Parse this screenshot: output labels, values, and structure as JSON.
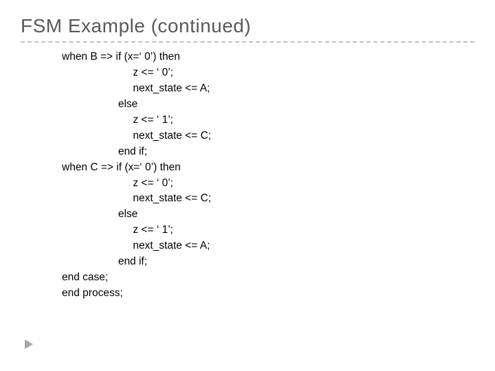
{
  "title": "FSM Example (continued)",
  "code": {
    "l01": "when B => if (x=‘ 0’) then",
    "l02": "                        z <= ‘ 0’;",
    "l03": "                        next_state <= A;",
    "l04": "                   else",
    "l05": "                        z <= ‘ 1’;",
    "l06": "                        next_state <= C;",
    "l07": "                   end if;",
    "l08": "when C => if (x=‘ 0’) then",
    "l09": "                        z <= ‘ 0’;",
    "l10": "                        next_state <= C;",
    "l11": "                   else",
    "l12": "                        z <= ‘ 1’;",
    "l13": "                        next_state <= A;",
    "l14": "                   end if;",
    "l15": "end case;",
    "l16": "end process;"
  }
}
